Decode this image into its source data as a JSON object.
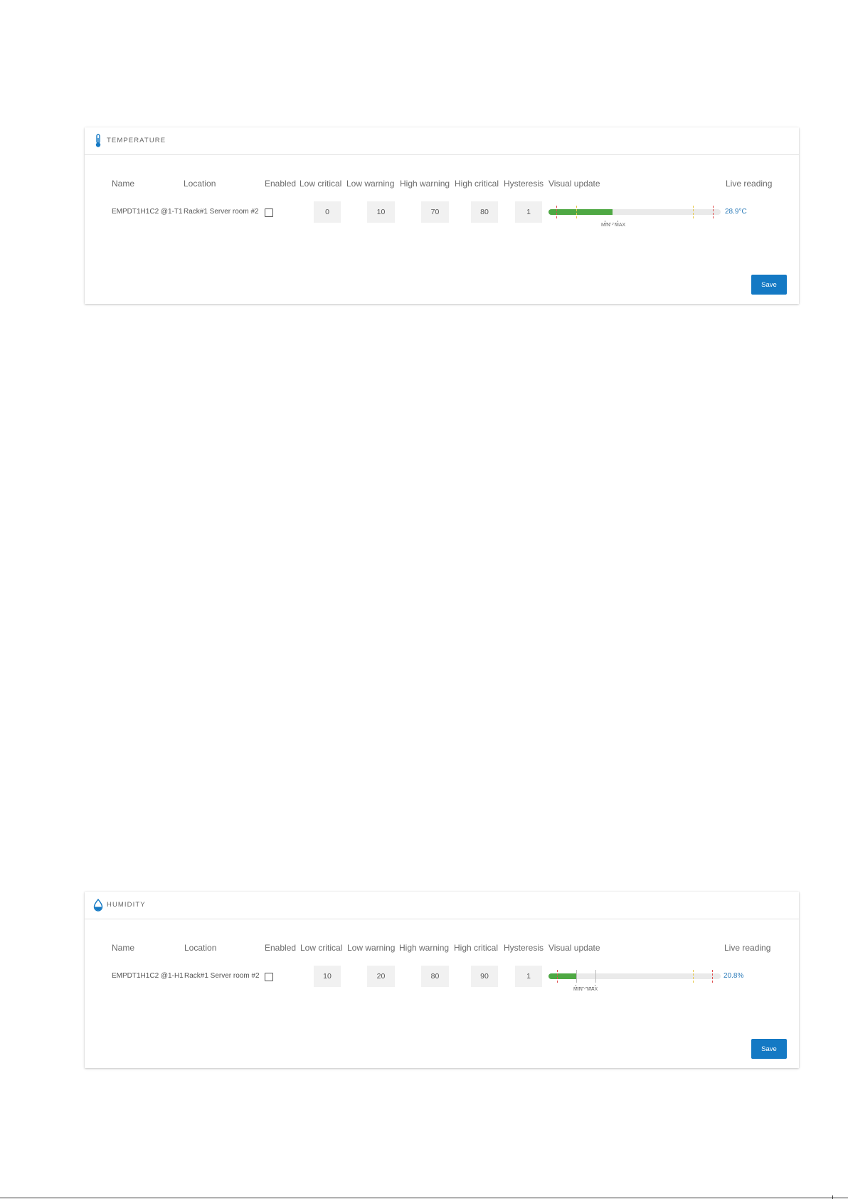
{
  "columns": {
    "name": "Name",
    "location": "Location",
    "enabled": "Enabled",
    "low_critical": "Low critical",
    "low_warning": "Low warning",
    "high_warning": "High warning",
    "high_critical": "High critical",
    "hysteresis": "Hysteresis",
    "visual_update": "Visual update",
    "live_reading": "Live reading"
  },
  "temperature": {
    "title": "TEMPERATURE",
    "icon": "thermometer-icon",
    "row": {
      "name": "EMPDT1H1C2 @1-T1",
      "location": "Rack#1 Server room #2",
      "enabled": false,
      "low_critical": "0",
      "low_warning": "10",
      "high_warning": "70",
      "high_critical": "80",
      "hysteresis": "1",
      "minmax_label": "MIN - MAX",
      "live_reading": "28.9°C",
      "bar_fill_fraction": 0.37
    },
    "save_label": "Save"
  },
  "humidity": {
    "title": "HUMIDITY",
    "icon": "water-drop-icon",
    "row": {
      "name": "EMPDT1H1C2 @1-H1",
      "location": "Rack#1 Server room #2",
      "enabled": false,
      "low_critical": "10",
      "low_warning": "20",
      "high_warning": "80",
      "high_critical": "90",
      "hysteresis": "1",
      "minmax_label": "MIN - MAX",
      "live_reading": "20.8%",
      "bar_fill_fraction": 0.16
    },
    "save_label": "Save"
  },
  "colors": {
    "accent": "#1479c4",
    "bar_fill": "#4ea843",
    "critical_marker": "#e05050",
    "warning_marker": "#e6c84a",
    "live_reading": "#2a7ab8"
  }
}
